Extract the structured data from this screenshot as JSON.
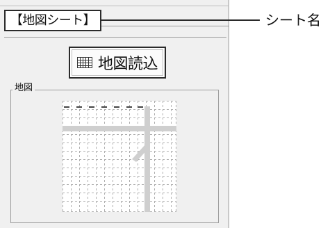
{
  "sheet_tab": {
    "label": "【地図シート】"
  },
  "callout": {
    "label": "シート名"
  },
  "toolbar": {
    "load_map_label": "地図読込",
    "load_map_icon": "grid-icon"
  },
  "map_group": {
    "label": "地図"
  },
  "colors": {
    "panel_background": "#f0f0f0",
    "border": "#2a2a2a",
    "grid_line": "#b0b0b0",
    "road": "#cfcfcf"
  }
}
